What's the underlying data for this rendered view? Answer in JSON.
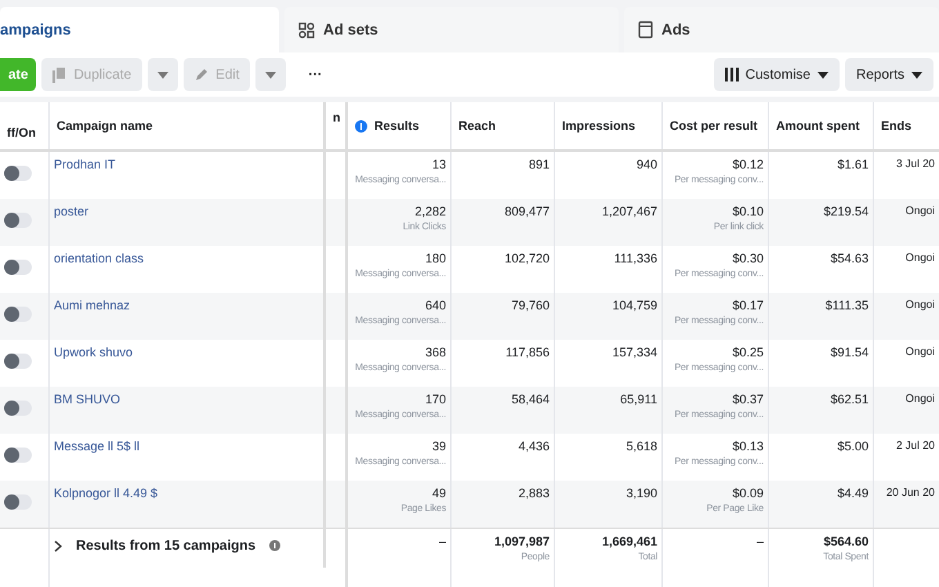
{
  "tabs": [
    {
      "label": "ampaigns",
      "kind": "campaigns",
      "selected": true
    },
    {
      "label": "Ad sets",
      "kind": "adsets",
      "selected": false
    },
    {
      "label": "Ads",
      "kind": "ads",
      "selected": false
    }
  ],
  "toolbar": {
    "create": "ate",
    "duplicate": "Duplicate",
    "edit": "Edit",
    "more": "···",
    "customise": "Customise",
    "reports": "Reports"
  },
  "table": {
    "columns": [
      "ff/On",
      "Campaign name",
      "n",
      "Results",
      "Reach",
      "Impressions",
      "Cost per result",
      "Amount spent",
      "Ends"
    ],
    "rows": [
      {
        "on": false,
        "name": "Prodhan IT",
        "results": "13",
        "results_type": "Messaging conversa...",
        "reach": "891",
        "impressions": "940",
        "cost": "$0.12",
        "cost_type": "Per messaging conv...",
        "spent": "$1.61",
        "ends": "3 Jul 20"
      },
      {
        "on": false,
        "name": "poster",
        "results": "2,282",
        "results_type": "Link Clicks",
        "reach": "809,477",
        "impressions": "1,207,467",
        "cost": "$0.10",
        "cost_type": "Per link click",
        "spent": "$219.54",
        "ends": "Ongoi"
      },
      {
        "on": false,
        "name": "orientation class",
        "results": "180",
        "results_type": "Messaging conversa...",
        "reach": "102,720",
        "impressions": "111,336",
        "cost": "$0.30",
        "cost_type": "Per messaging conv...",
        "spent": "$54.63",
        "ends": "Ongoi"
      },
      {
        "on": false,
        "name": "Aumi mehnaz",
        "results": "640",
        "results_type": "Messaging conversa...",
        "reach": "79,760",
        "impressions": "104,759",
        "cost": "$0.17",
        "cost_type": "Per messaging conv...",
        "spent": "$111.35",
        "ends": "Ongoi"
      },
      {
        "on": false,
        "name": "Upwork shuvo",
        "results": "368",
        "results_type": "Messaging conversa...",
        "reach": "117,856",
        "impressions": "157,334",
        "cost": "$0.25",
        "cost_type": "Per messaging conv...",
        "spent": "$91.54",
        "ends": "Ongoi"
      },
      {
        "on": false,
        "name": "BM SHUVO",
        "results": "170",
        "results_type": "Messaging conversa...",
        "reach": "58,464",
        "impressions": "65,911",
        "cost": "$0.37",
        "cost_type": "Per messaging conv...",
        "spent": "$62.51",
        "ends": "Ongoi"
      },
      {
        "on": false,
        "name": "Message ll 5$ ll",
        "results": "39",
        "results_type": "Messaging conversa...",
        "reach": "4,436",
        "impressions": "5,618",
        "cost": "$0.13",
        "cost_type": "Per messaging conv...",
        "spent": "$5.00",
        "ends": "2 Jul 20"
      },
      {
        "on": false,
        "name": "Kolpnogor ll 4.49 $",
        "results": "49",
        "results_type": "Page Likes",
        "reach": "2,883",
        "impressions": "3,190",
        "cost": "$0.09",
        "cost_type": "Per Page Like",
        "spent": "$4.49",
        "ends": "20 Jun 20"
      }
    ],
    "summary": {
      "label": "Results from 15 campaigns",
      "results": "–",
      "reach": "1,097,987",
      "reach_note": "People",
      "impressions": "1,669,461",
      "impressions_note": "Total",
      "cost": "–",
      "spent": "$564.60",
      "spent_note": "Total Spent"
    }
  }
}
